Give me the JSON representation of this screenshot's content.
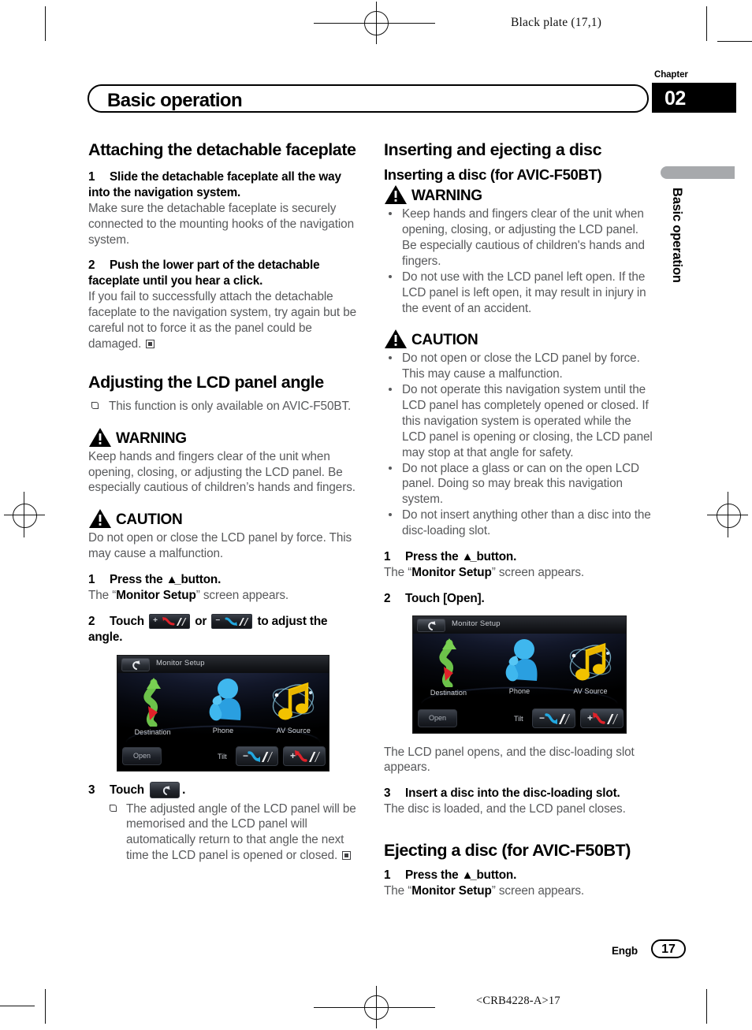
{
  "page": {
    "black_plate": "Black plate (17,1)",
    "chapter_label": "Chapter",
    "chapter_number": "02",
    "header_title": "Basic operation",
    "side_tab": "Basic operation",
    "footer_language": "Engb",
    "page_number": "17",
    "print_code": "<CRB4228-A>17"
  },
  "left": {
    "h1_attaching": "Attaching the detachable faceplate",
    "step1_num": "1",
    "step1_title": "Slide the detachable faceplate all the way into the navigation system.",
    "step1_body": "Make sure the detachable faceplate is securely connected to the mounting hooks of the navigation system.",
    "step2_num": "2",
    "step2_title": "Push the lower part of the detachable faceplate until you hear a click.",
    "step2_body": "If you fail to successfully attach the detachable faceplate to the navigation system, try again but be careful not to force it as the panel could be damaged.",
    "h1_adjusting": "Adjusting the LCD panel angle",
    "note_avic": "This function is only available on AVIC-F50BT.",
    "warning_label": "WARNING",
    "warning_body": "Keep hands and fingers clear of the unit when opening, closing, or adjusting the LCD panel. Be especially cautious of children’s hands and fingers.",
    "caution_label": "CAUTION",
    "caution_body": "Do not open or close the LCD panel by force. This may cause a malfunction.",
    "s1_num": "1",
    "s1_pre": "Press the",
    "s1_post": "button.",
    "s1_body_pre": "The “",
    "s1_body_bold": "Monitor Setup",
    "s1_body_post": "” screen appears.",
    "s2_num": "2",
    "s2_pre": "Touch",
    "s2_mid": "or",
    "s2_post": "to adjust the angle.",
    "s3_num": "3",
    "s3_pre": "Touch",
    "s3_post": ".",
    "s3_note": "The adjusted angle of the LCD panel will be memorised and the LCD panel will automatically return to that angle the next time the LCD panel is opened or closed.",
    "chip_plus_sign": "+",
    "chip_minus_sign": "−"
  },
  "right": {
    "h1_inserting": "Inserting and ejecting a disc",
    "h2_inserting": "Inserting a disc (for AVIC-F50BT)",
    "warning_label": "WARNING",
    "warning_bullets": [
      "Keep hands and fingers clear of the unit when opening, closing, or adjusting the LCD panel. Be especially cautious of children's hands and fingers.",
      "Do not use with the LCD panel left open. If the LCD panel is left open, it may result in injury in the event of an accident."
    ],
    "caution_label": "CAUTION",
    "caution_bullets": [
      "Do not open or close the LCD panel by force. This may cause a malfunction.",
      "Do not operate this navigation system until the LCD panel has completely opened or closed. If this navigation system is operated while the LCD panel is opening or closing, the LCD panel may stop at that angle for safety.",
      "Do not place a glass or can on the open LCD panel. Doing so may break this navigation system.",
      "Do not insert anything other than a disc into the disc-loading slot."
    ],
    "s1_num": "1",
    "s1_pre": "Press the",
    "s1_post": "button.",
    "s1_body_pre": "The “",
    "s1_body_bold": "Monitor Setup",
    "s1_body_post": "” screen appears.",
    "s2_num": "2",
    "s2_title": "Touch [Open].",
    "after_shot": "The LCD panel opens, and the disc-loading slot appears.",
    "s3_num": "3",
    "s3_title": "Insert a disc into the disc-loading slot.",
    "s3_body": "The disc is loaded, and the LCD panel closes.",
    "h2_ejecting": "Ejecting a disc (for AVIC-F50BT)",
    "e1_num": "1",
    "e1_pre": "Press the",
    "e1_post": "button.",
    "e1_body_pre": "The “",
    "e1_body_bold": "Monitor Setup",
    "e1_body_post": "” screen appears."
  },
  "screenshot": {
    "title": "Monitor Setup",
    "back_icon": "back-arrow-icon",
    "icons": [
      {
        "label": "Destination",
        "icon": "destination-arrow-icon"
      },
      {
        "label": "Phone",
        "icon": "phone-person-icon"
      },
      {
        "label": "AV Source",
        "icon": "music-note-icon"
      }
    ],
    "open_label": "Open",
    "tilt_label": "Tilt",
    "tilt_minus": "−",
    "tilt_plus": "+"
  },
  "colors": {
    "body_text": "#58595b",
    "accent_tab": "#a7a9ac",
    "tilt_plus_arrow": "#e0222a",
    "tilt_minus_arrow": "#22a8e0",
    "destination_green": "#6cc24a",
    "destination_red": "#e0222a",
    "phone_blue": "#2aa8e8",
    "av_yellow": "#f2c200"
  }
}
